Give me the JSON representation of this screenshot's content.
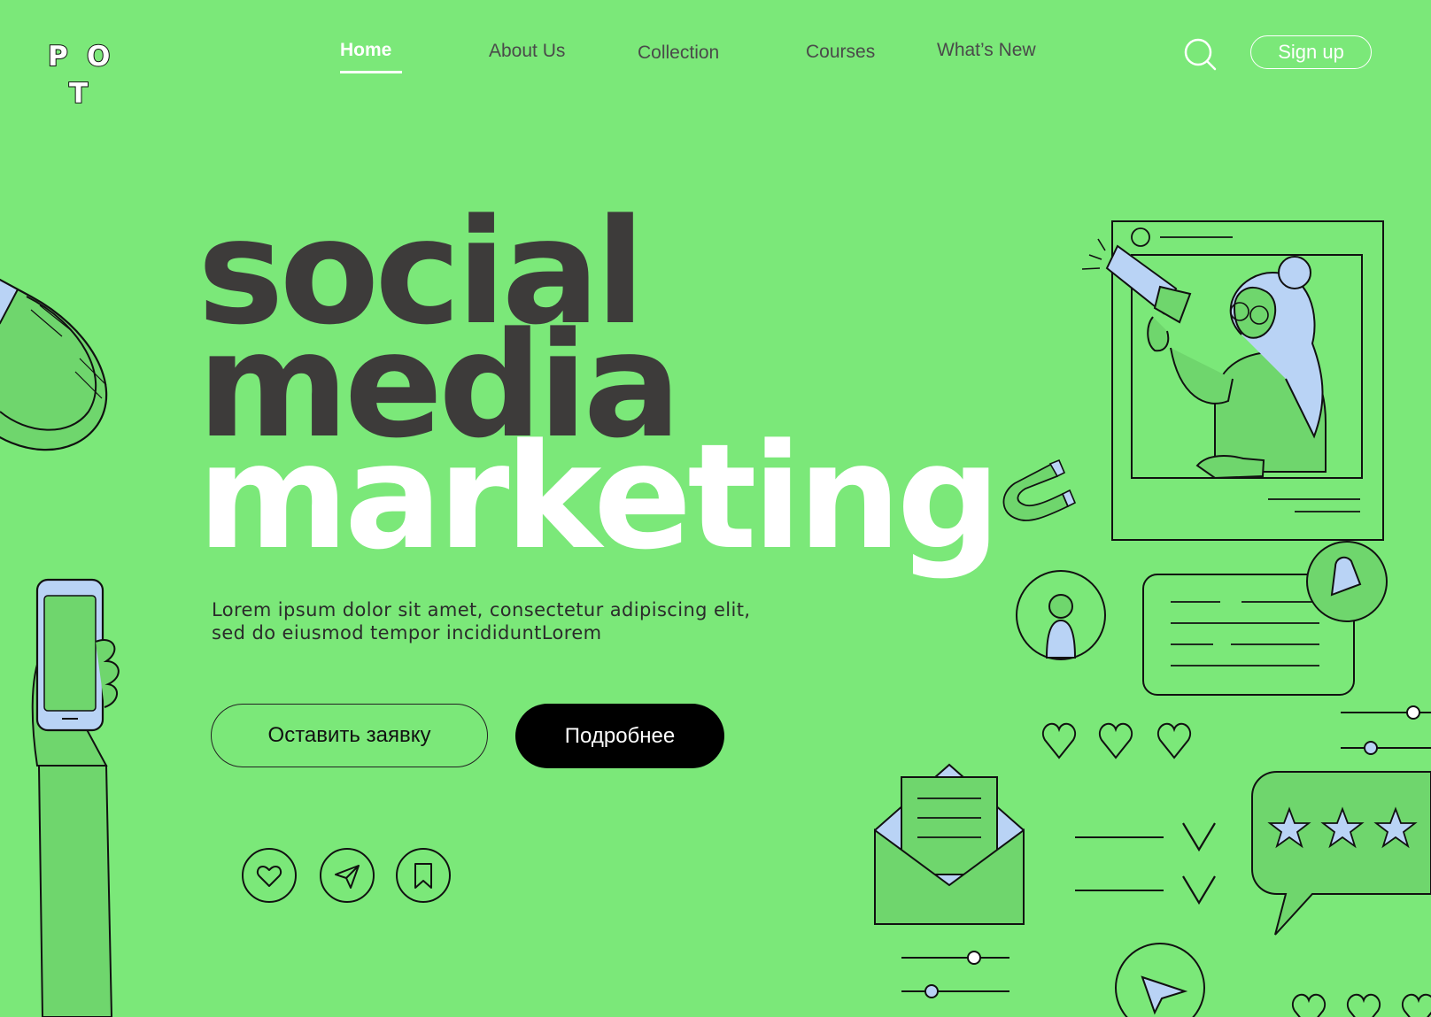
{
  "logo": {
    "letters": [
      "P",
      "O",
      "T"
    ]
  },
  "nav": {
    "items": [
      {
        "label": "Home",
        "active": true
      },
      {
        "label": "About Us",
        "active": false
      },
      {
        "label": "Collection",
        "active": false
      },
      {
        "label": "Courses",
        "active": false
      },
      {
        "label": "What’s New",
        "active": false
      }
    ]
  },
  "header": {
    "signup_label": "Sign up",
    "search_icon": "search-icon"
  },
  "hero": {
    "line1": "social",
    "line2": "media",
    "line3": "marketing",
    "body_line1": "Lorem ipsum dolor sit amet, consectetur adipiscing elit,",
    "body_line2": "sed do eiusmod tempor incididuntLorem",
    "primary_button": "Оставить заявку",
    "secondary_button": "Подробнее"
  },
  "action_icons": [
    "heart-icon",
    "send-icon",
    "bookmark-icon"
  ],
  "colors": {
    "background": "#7be879",
    "dark_text": "#3d3b3a",
    "white": "#ffffff",
    "accent_blue": "#b9d3f5",
    "button_dark": "#000000"
  }
}
